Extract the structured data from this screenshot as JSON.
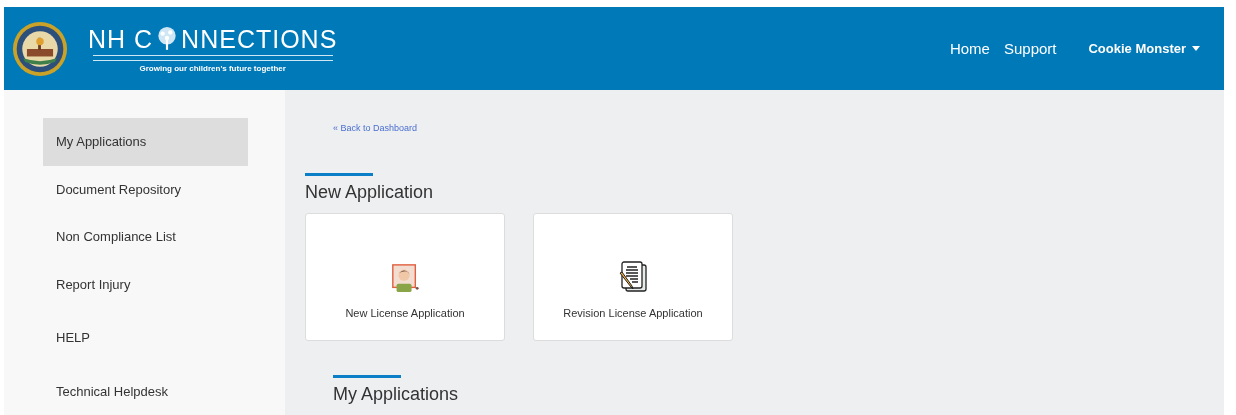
{
  "header": {
    "logo": {
      "title_before": "NH C",
      "title_after": "NNECTIONS",
      "tagline": "Growing our children's future together"
    },
    "nav": [
      "Home",
      "Support"
    ],
    "user": {
      "name": "Cookie Monster"
    }
  },
  "sidebar": {
    "items": [
      {
        "kind": "link",
        "label": "My Applications",
        "selected": true
      },
      {
        "kind": "link",
        "label": "Document Repository",
        "selected": false
      },
      {
        "kind": "link",
        "label": "Non Compliance List",
        "selected": false
      },
      {
        "kind": "link",
        "label": "Report Injury",
        "selected": false
      },
      {
        "kind": "heading",
        "label": "HELP"
      },
      {
        "kind": "link",
        "label": "Technical Helpdesk",
        "selected": false
      }
    ]
  },
  "main": {
    "back_link": "« Back to Dashboard",
    "new_application": {
      "title": "New Application",
      "cards": [
        {
          "kind": "person",
          "label": "New License Application"
        },
        {
          "kind": "document",
          "label": "Revision License Application"
        }
      ]
    },
    "my_applications": {
      "title": "My Applications"
    }
  }
}
